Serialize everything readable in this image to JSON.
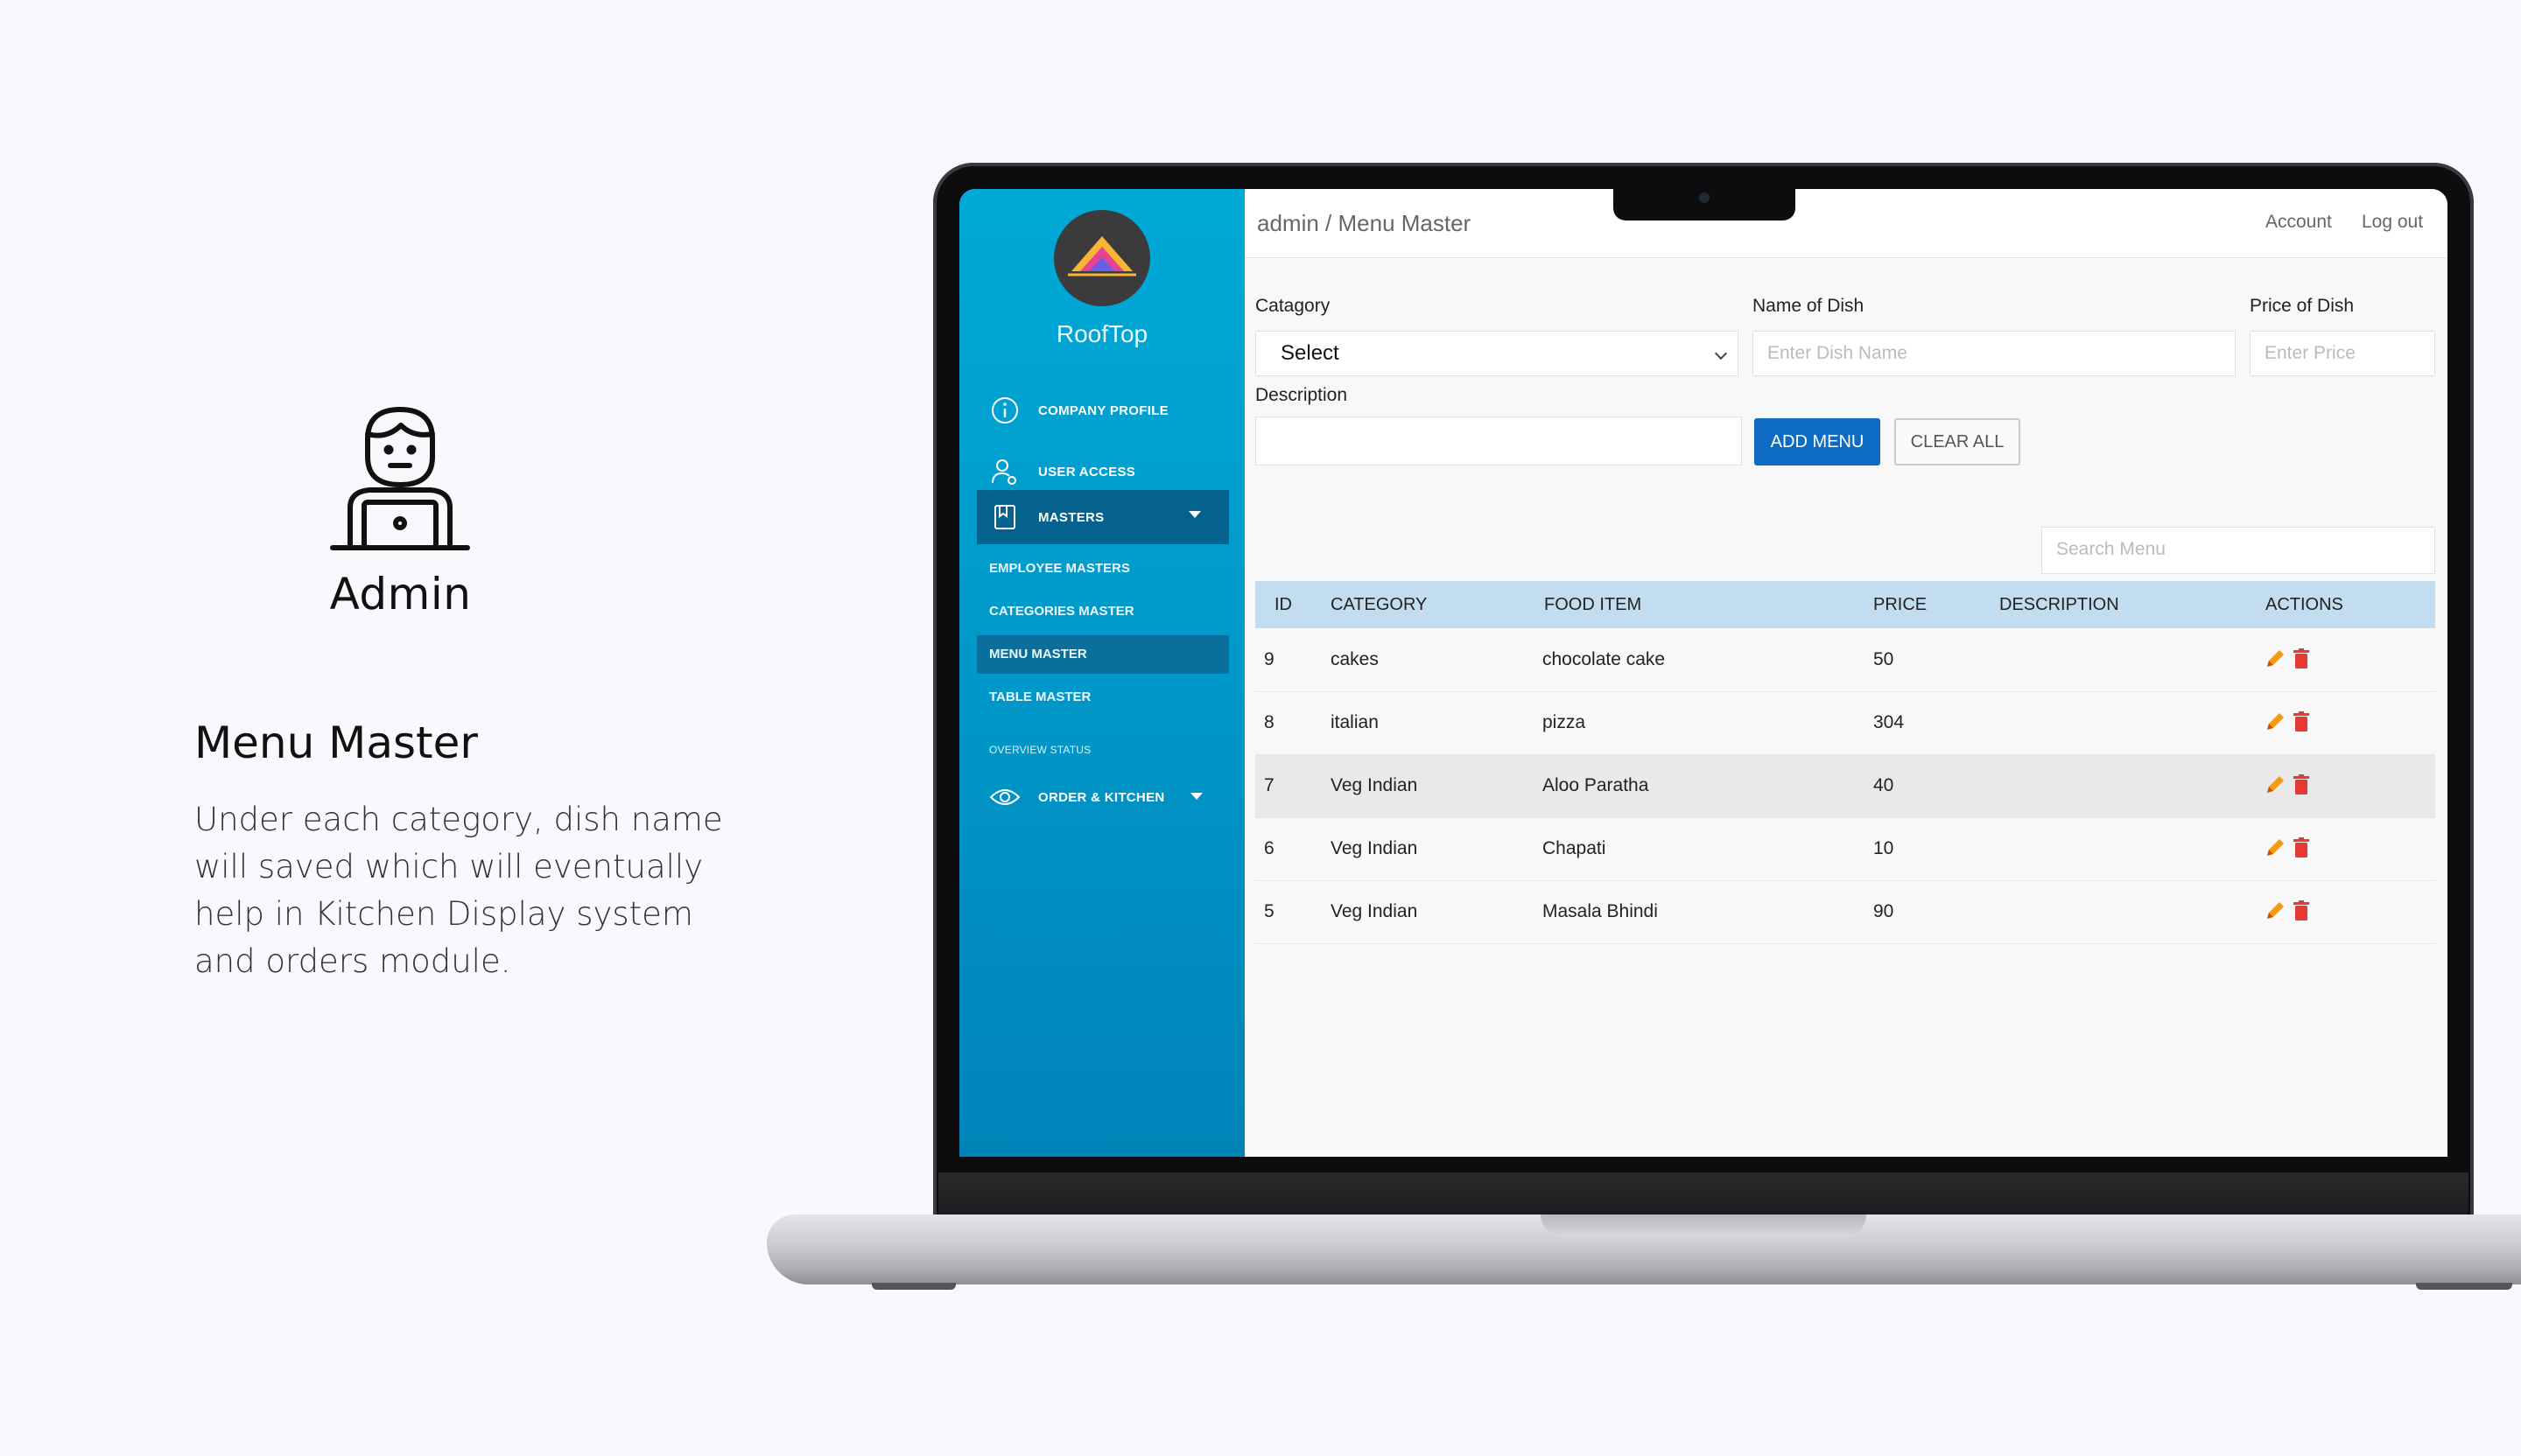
{
  "presentation": {
    "role_title": "Admin",
    "section_title": "Menu Master",
    "section_description": "Under each category, dish name will saved which will eventually help in Kitchen Display system and orders module."
  },
  "sidebar": {
    "brand": "RoofTop",
    "nav": [
      {
        "label": "COMPANY PROFILE",
        "icon": "info-icon"
      },
      {
        "label": "USER ACCESS",
        "icon": "user-settings-icon"
      },
      {
        "label": "MASTERS",
        "icon": "book-icon",
        "expanded": true
      }
    ],
    "sub_items": [
      {
        "label": "EMPLOYEE MASTERS"
      },
      {
        "label": "CATEGORIES MASTER"
      },
      {
        "label": "MENU MASTER",
        "active": true
      },
      {
        "label": "TABLE MASTER"
      }
    ],
    "overview_label": "OVERVIEW STATUS",
    "order_kitchen": {
      "label": "ORDER & KITCHEN",
      "icon": "eye-icon"
    }
  },
  "topbar": {
    "breadcrumb": "admin / Menu Master",
    "account": "Account",
    "logout": "Log out"
  },
  "form": {
    "category_label": "Catagory",
    "category_value": "Select",
    "dish_label": "Name of Dish",
    "dish_placeholder": "Enter Dish Name",
    "price_label": "Price of Dish",
    "price_placeholder": "Enter Price",
    "description_label": "Description",
    "description_value": "",
    "add_button": "ADD MENU",
    "clear_button": "CLEAR ALL",
    "search_placeholder": "Search Menu"
  },
  "table": {
    "headers": [
      "ID",
      "CATEGORY",
      "FOOD ITEM",
      "PRICE",
      "DESCRIPTION",
      "ACTIONS"
    ],
    "rows": [
      {
        "id": "9",
        "category": "cakes",
        "food": "chocolate cake",
        "price": "50",
        "description": ""
      },
      {
        "id": "8",
        "category": "italian",
        "food": "pizza",
        "price": "304",
        "description": ""
      },
      {
        "id": "7",
        "category": "Veg Indian",
        "food": "Aloo Paratha",
        "price": "40",
        "description": ""
      },
      {
        "id": "6",
        "category": "Veg Indian",
        "food": "Chapati",
        "price": "10",
        "description": ""
      },
      {
        "id": "5",
        "category": "Veg Indian",
        "food": "Masala Bhindi",
        "price": "90",
        "description": ""
      }
    ]
  },
  "colors": {
    "sidebar_top": "#00a9d6",
    "sidebar_bottom": "#0083b8",
    "primary_button": "#0d6bc4",
    "table_header": "#c3ddf0",
    "edit_icon": "#f39c12",
    "delete_icon": "#e53935"
  }
}
